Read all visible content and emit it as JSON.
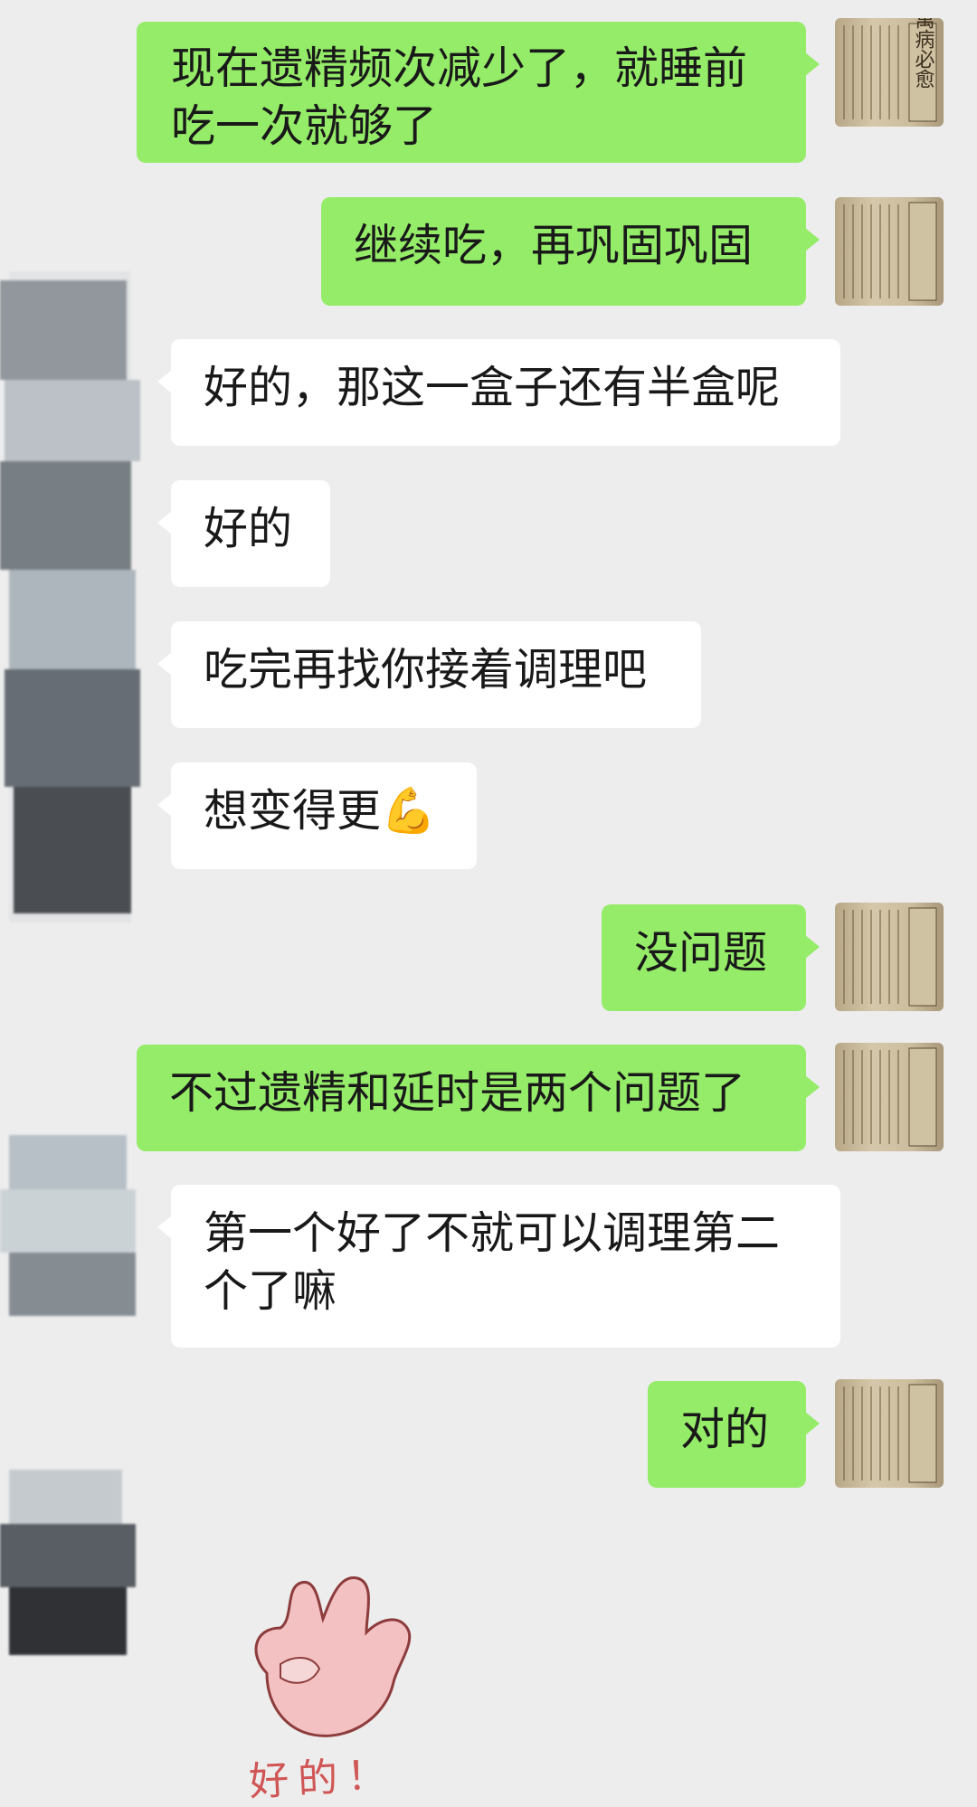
{
  "chat": {
    "messages": [
      {
        "sender": "me",
        "text": "现在遗精频次减少了，就睡前吃一次就够了"
      },
      {
        "sender": "me",
        "text": "继续吃，再巩固巩固"
      },
      {
        "sender": "other",
        "text": "好的，那这一盒子还有半盒呢"
      },
      {
        "sender": "other",
        "text": "好的"
      },
      {
        "sender": "other",
        "text": "吃完再找你接着调理吧"
      },
      {
        "sender": "other",
        "text": "想变得更💪"
      },
      {
        "sender": "me",
        "text": "没问题"
      },
      {
        "sender": "me",
        "text": "不过遗精和延时是两个问题了"
      },
      {
        "sender": "other",
        "text": "第一个好了不就可以调理第二个了嘛"
      },
      {
        "sender": "me",
        "text": "对的"
      }
    ],
    "sticker": {
      "caption": "好的！",
      "name": "ok-hand-sticker"
    },
    "avatar_right": {
      "icon": "old-book-cover-avatar",
      "text": "萬病必愈"
    }
  },
  "colors": {
    "background": "#ededed",
    "outgoing_bubble": "#95ec69",
    "incoming_bubble": "#ffffff",
    "text": "#191919"
  }
}
